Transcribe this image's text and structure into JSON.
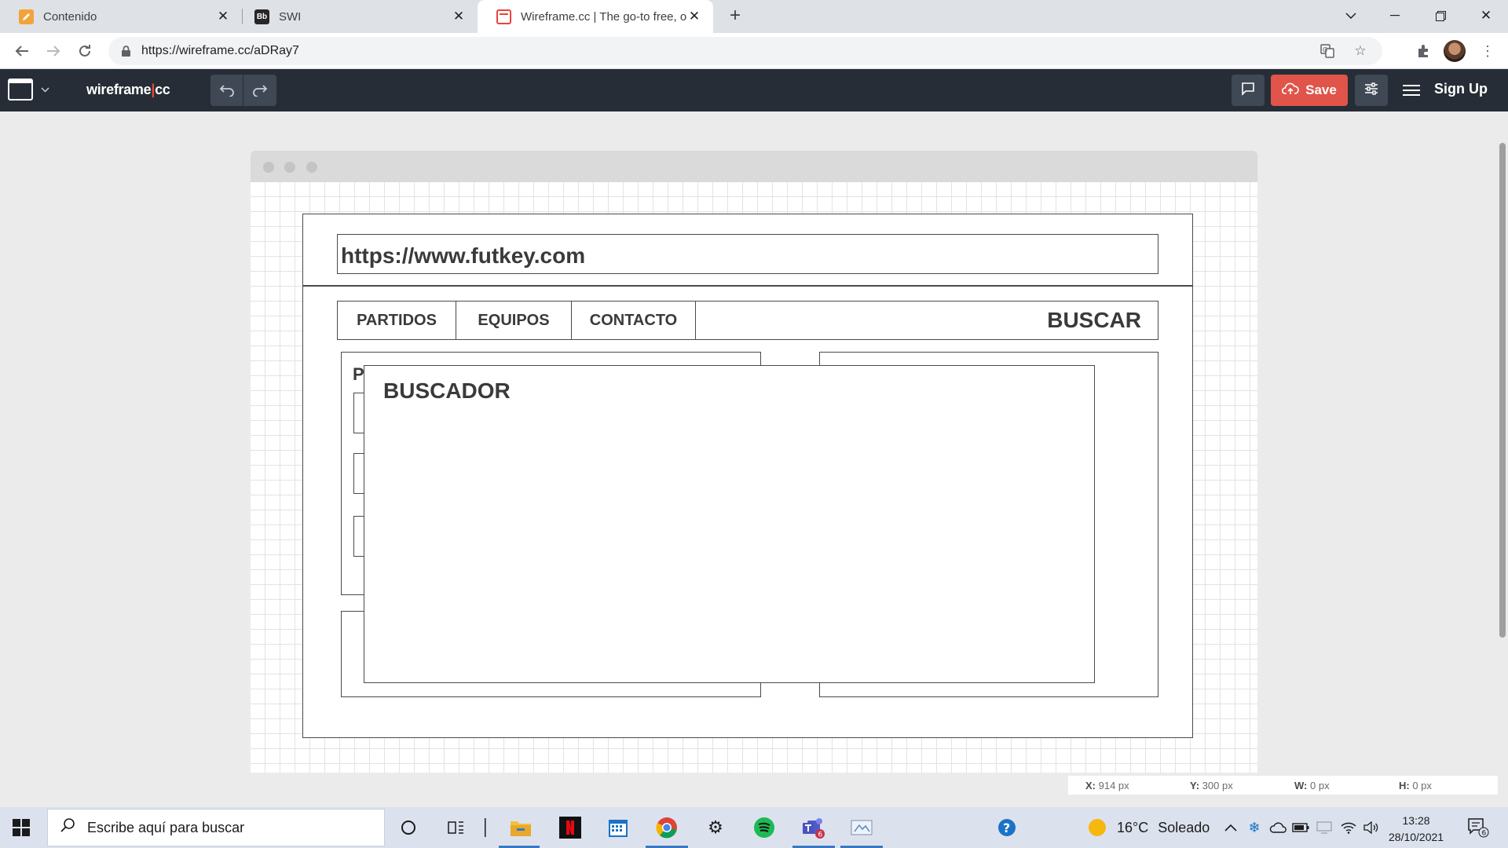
{
  "browser": {
    "tabs": [
      {
        "title": "Contenido",
        "favicon": "pencil-icon",
        "favicon_color": "#f2a33a",
        "active": false
      },
      {
        "title": "SWI",
        "favicon_text": "Bb",
        "favicon_color": "#262626",
        "active": false
      },
      {
        "title": "Wireframe.cc | The go-to free, on",
        "favicon": "wireframe-icon",
        "favicon_color": "#e8453c",
        "active": true
      }
    ],
    "url": "https://wireframe.cc/aDRay7"
  },
  "app": {
    "logo_main": "wireframe",
    "logo_sep": "|",
    "logo_suffix": "cc",
    "save_label": "Save",
    "signup_label": "Sign Up",
    "accent_color": "#e0544a"
  },
  "wireframe": {
    "url_text": "https://www.futkey.com",
    "nav": [
      "PARTIDOS",
      "EQUIPOS",
      "CONTACTO"
    ],
    "search_label": "BUSCAR",
    "panel_letter": "P",
    "modal_title": "BUSCADOR"
  },
  "status": {
    "x_label": "X:",
    "x_value": "914 px",
    "y_label": "Y:",
    "y_value": "300 px",
    "w_label": "W:",
    "w_value": "0 px",
    "h_label": "H:",
    "h_value": "0 px"
  },
  "taskbar": {
    "search_placeholder": "Escribe aquí para buscar",
    "teams_badge": "6",
    "weather_temp": "16°C",
    "weather_text": "Soleado",
    "time": "13:28",
    "date": "28/10/2021",
    "notification_count": "6"
  }
}
